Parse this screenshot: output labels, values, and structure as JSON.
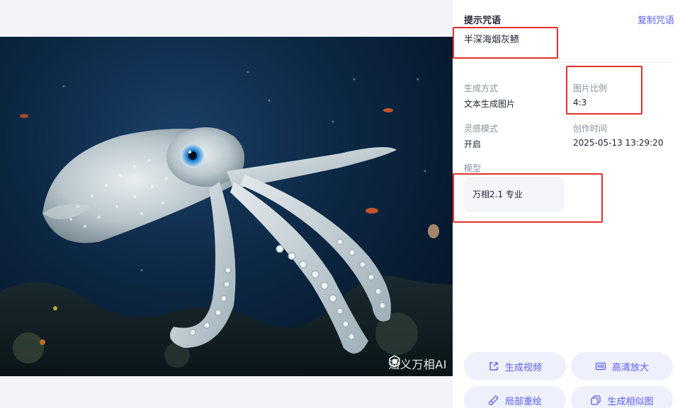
{
  "panel": {
    "prompt_title": "提示咒语",
    "copy_label": "复制咒语",
    "prompt_text": "半深海烟灰鲼"
  },
  "meta": {
    "method_label": "生成方式",
    "method_value": "文本生成图片",
    "ratio_label": "图片比例",
    "ratio_value": "4:3",
    "inspiration_label": "灵感模式",
    "inspiration_value": "开启",
    "created_label": "创作时间",
    "created_value": "2025-05-13 13:29:20",
    "model_label": "模型",
    "model_value": "万相2.1 专业"
  },
  "watermark": "通义万相AI",
  "actions": {
    "video": "生成视频",
    "upscale": "高清放大",
    "repaint": "局部重绘",
    "similar": "生成相似图"
  },
  "colors": {
    "accent": "#5b5ff0",
    "annotation": "#e0302a",
    "button_bg": "#eef0fc"
  }
}
